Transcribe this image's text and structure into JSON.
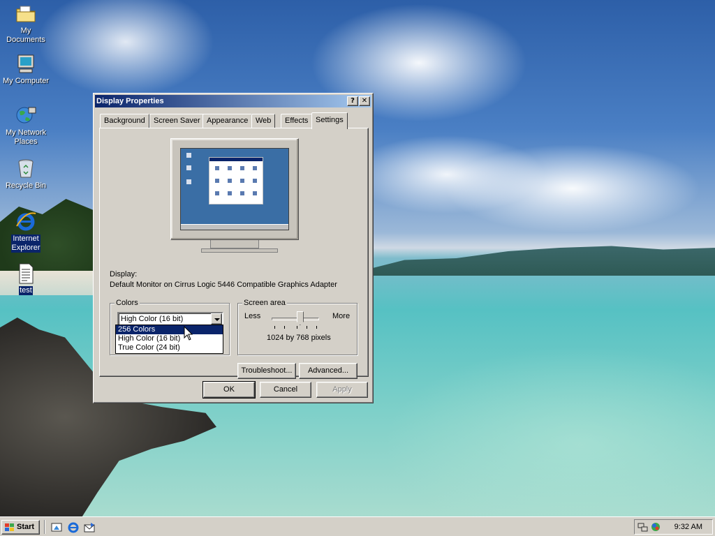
{
  "desktop": {
    "icons": [
      {
        "label": "My Documents"
      },
      {
        "label": "My Computer"
      },
      {
        "label": "My Network Places",
        "label_line1": "My Network",
        "label_line2": "Places"
      },
      {
        "label": "Recycle Bin"
      },
      {
        "label": "Internet Explorer",
        "label_line1": "Internet",
        "label_line2": "Explorer"
      },
      {
        "label": "test"
      }
    ]
  },
  "window": {
    "title": "Display Properties",
    "help_button": "?",
    "close_button": "✕",
    "tabs": [
      {
        "label": "Background",
        "active": false
      },
      {
        "label": "Screen Saver",
        "active": false
      },
      {
        "label": "Appearance",
        "active": false
      },
      {
        "label": "Web",
        "active": false
      },
      {
        "label": "Effects",
        "active": false
      },
      {
        "label": "Settings",
        "active": true
      }
    ],
    "settings": {
      "display_label": "Display:",
      "display_value": "Default Monitor on Cirrus Logic 5446 Compatible Graphics Adapter",
      "colors": {
        "title": "Colors",
        "selected": "High Color (16 bit)",
        "options": [
          "256 Colors",
          "High Color (16 bit)",
          "True Color (24 bit)"
        ],
        "highlighted_index": 0
      },
      "screen_area": {
        "title": "Screen area",
        "less_label": "Less",
        "more_label": "More",
        "value_text": "1024 by 768 pixels",
        "slider_position": 0.6
      },
      "troubleshoot_label": "Troubleshoot...",
      "advanced_label": "Advanced..."
    },
    "buttons": {
      "ok": "OK",
      "cancel": "Cancel",
      "apply": "Apply",
      "apply_enabled": false
    }
  },
  "taskbar": {
    "start_label": "Start",
    "quick_launch": [
      "show-desktop-icon",
      "internet-explorer-icon",
      "outlook-express-icon"
    ],
    "tray_icons": [
      "network-icon",
      "volume-icon"
    ],
    "clock": "9:32 AM"
  },
  "colors": {
    "title_bar": "#0a246a",
    "title_bar_end": "#a6caf0",
    "face": "#d4d0c8",
    "selection": "#0a246a",
    "desktop_blue": "#3a6ea5"
  }
}
